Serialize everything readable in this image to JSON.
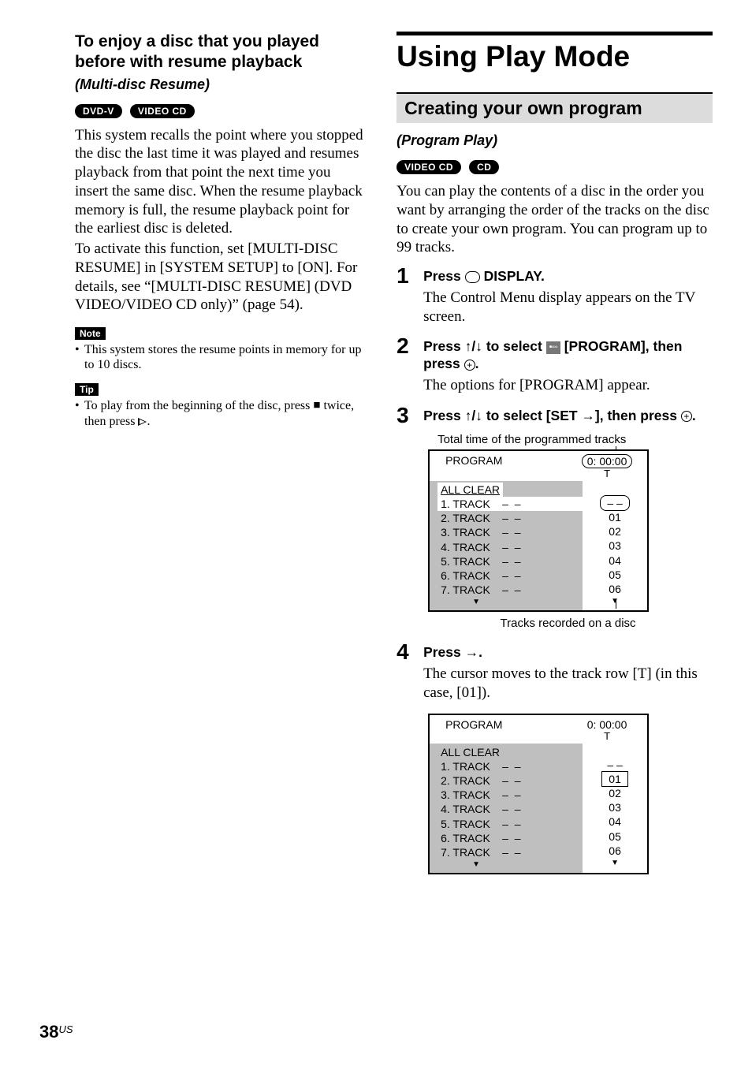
{
  "left": {
    "heading_l1": "To enjoy a disc that you played",
    "heading_l2": "before with resume playback",
    "sub_italic": "(Multi-disc Resume)",
    "badges": [
      "DVD-V",
      "VIDEO CD"
    ],
    "para1": "This system recalls the point where you stopped the disc the last time it was played and resumes playback from that point the next time you insert the same disc. When the resume playback memory is full, the resume playback point for the earliest disc is deleted.",
    "para2": "To activate this function, set [MULTI-DISC RESUME] in [SYSTEM SETUP] to [ON]. For details, see “[MULTI-DISC RESUME] (DVD VIDEO/VIDEO CD only)” (page 54).",
    "note_label": "Note",
    "note_text": "This system stores the resume points in memory for up to 10 discs.",
    "tip_label": "Tip",
    "tip_text_a": "To play from the beginning of the disc, press ",
    "tip_text_b": " twice, then press ",
    "tip_text_c": "."
  },
  "right": {
    "section_title": "Using Play Mode",
    "subsection": "Creating your own program",
    "sub_italic": "(Program Play)",
    "badges": [
      "VIDEO CD",
      "CD"
    ],
    "intro": "You can play the contents of a disc in the order you want by arranging the order of the tracks on the disc to create your own program. You can program up to 99 tracks.",
    "steps": [
      {
        "num": "1",
        "instr_a": "Press ",
        "instr_b": " DISPLAY.",
        "desc": "The Control Menu display appears on the TV screen."
      },
      {
        "num": "2",
        "instr_a": "Press ↑/↓ to select ",
        "instr_b": " [PROGRAM], then press ",
        "instr_c": ".",
        "desc": "The options for [PROGRAM] appear."
      },
      {
        "num": "3",
        "instr_a": "Press ↑/↓ to select [SET →], then press ",
        "instr_b": "."
      },
      {
        "num": "4",
        "instr_a": "Press →.",
        "desc": "The cursor moves to the track row [T] (in this case, [01])."
      }
    ],
    "caption_top": "Total time of the programmed tracks",
    "caption_mid": "Tracks recorded on a disc",
    "osd": {
      "header": "PROGRAM",
      "time": "0: 00:00",
      "t": "T",
      "all_clear": "ALL CLEAR",
      "rows": [
        {
          "l": "1. TRACK",
          "v": "– –"
        },
        {
          "l": "2. TRACK",
          "v": "– –"
        },
        {
          "l": "3. TRACK",
          "v": "– –"
        },
        {
          "l": "4. TRACK",
          "v": "– –"
        },
        {
          "l": "5. TRACK",
          "v": "– –"
        },
        {
          "l": "6. TRACK",
          "v": "– –"
        },
        {
          "l": "7. TRACK",
          "v": "– –"
        }
      ],
      "right_rows": [
        "– –",
        "01",
        "02",
        "03",
        "04",
        "05",
        "06"
      ]
    }
  },
  "page": {
    "num": "38",
    "region": "US"
  }
}
